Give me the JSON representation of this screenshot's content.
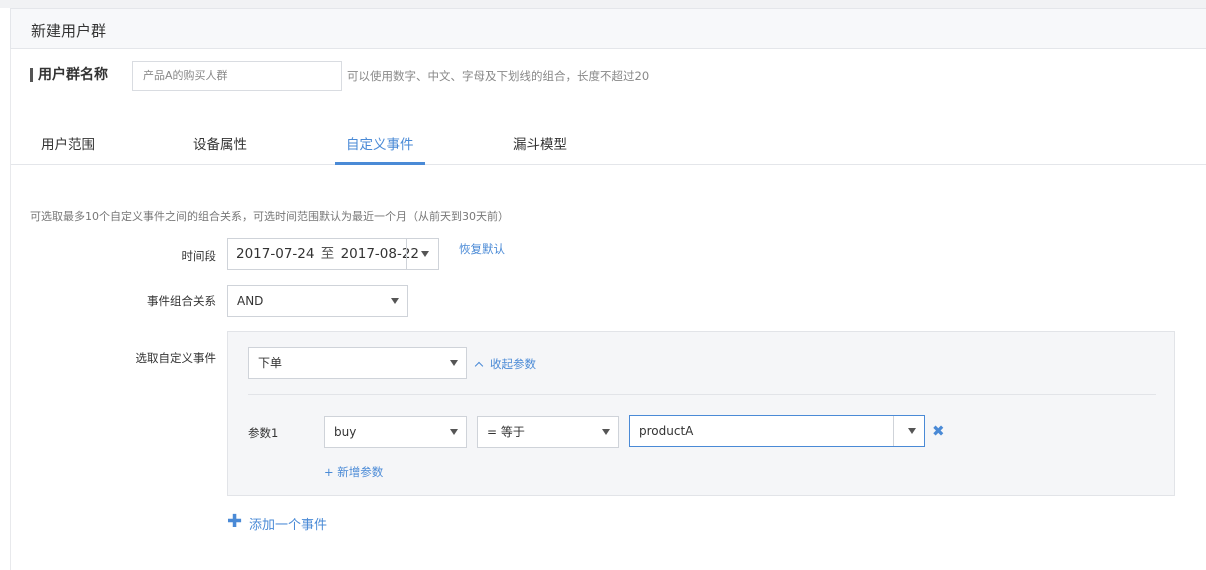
{
  "header": {
    "title": "新建用户群"
  },
  "group_name": {
    "label": "用户群名称",
    "value": "产品A的购买人群",
    "hint": "可以使用数字、中文、字母及下划线的组合，长度不超过20"
  },
  "tabs": [
    {
      "label": "用户范围",
      "active": false
    },
    {
      "label": "设备属性",
      "active": false
    },
    {
      "label": "自定义事件",
      "active": true
    },
    {
      "label": "漏斗模型",
      "active": false
    }
  ],
  "custom_event": {
    "note": "可选取最多10个自定义事件之间的组合关系，可选时间范围默认为最近一个月（从前天到30天前）",
    "period": {
      "label": "时间段",
      "start": "2017-07-24",
      "separator": "至",
      "end": "2017-08-22",
      "reset_link": "恢复默认"
    },
    "combination": {
      "label": "事件组合关系",
      "value": "AND"
    },
    "event_select": {
      "label": "选取自定义事件",
      "event_value": "下单",
      "collapse_link": "收起参数",
      "param": {
        "label": "参数1",
        "key": "buy",
        "operator": "= 等于",
        "value": "productA"
      },
      "add_param_link": "+ 新增参数"
    },
    "add_event": {
      "icon": "plus-icon",
      "label": "添加一个事件"
    }
  },
  "colors": {
    "accent": "#4a8ad6",
    "header_bg": "#f7f8fa",
    "panel_bg": "#f5f6f8"
  }
}
